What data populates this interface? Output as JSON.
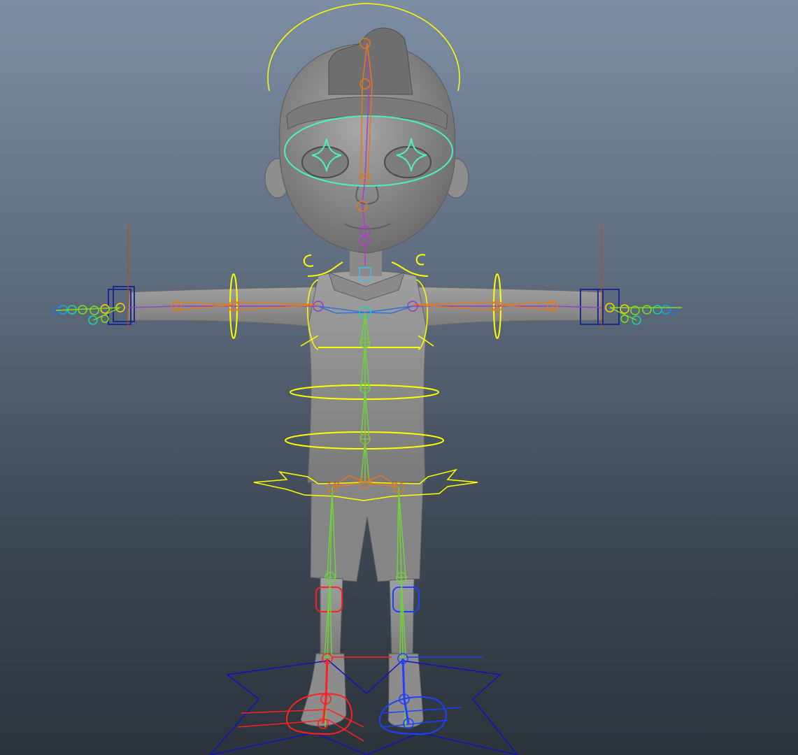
{
  "viewport": {
    "background_top": "#7d8ea4",
    "background_bottom": "#2c333b",
    "shading_mode": "smooth-shaded"
  },
  "character": {
    "kind": "cartoon-boy",
    "pose": "T-pose",
    "mesh_color": "#8f8f8f",
    "mesh_dark": "#5a5a5a"
  },
  "rig_colors": {
    "yellow_controls": "#ffff00",
    "face_control": "#4df0c0",
    "spine_joints": "#6fd13c",
    "neck_joints": "#b03cc8",
    "arm_joints": "#9a3cc8",
    "elbow_joints": "#e07a1c",
    "left_leg_ik": "#ff2020",
    "right_leg_ik": "#2040ff",
    "foot_star_control": "#1010c0",
    "wrist_control": "#1a2a90",
    "hand_fingers": [
      "#ffd200",
      "#7de01a",
      "#18d89a",
      "#18a8e8",
      "#2470e8"
    ]
  }
}
